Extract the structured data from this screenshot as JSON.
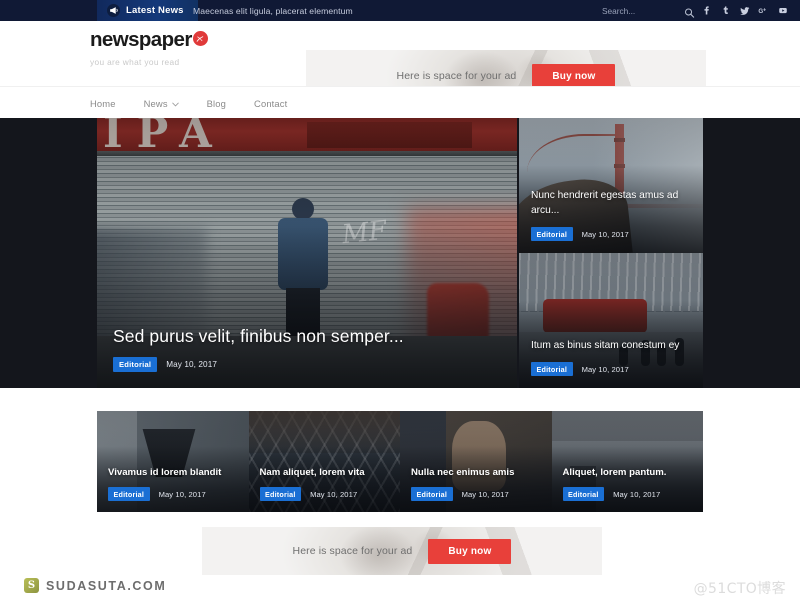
{
  "topbar": {
    "latest_news_label": "Latest News",
    "megaphone_icon": "megaphone-icon",
    "ticker_text": "Maecenas elit ligula, placerat elementum",
    "search_placeholder": "Search...",
    "search_value": "",
    "search_icon": "search-icon",
    "socials": [
      {
        "name": "facebook-icon",
        "label": "f"
      },
      {
        "name": "tumblr-icon",
        "label": "t"
      },
      {
        "name": "twitter-icon",
        "label": "y"
      },
      {
        "name": "google-plus-icon",
        "label": "G+"
      },
      {
        "name": "youtube-icon",
        "label": "yt"
      }
    ],
    "bg_color": "#101935",
    "latest_bg_color": "#123a7a"
  },
  "header": {
    "logo_text": "newspaper",
    "logo_mark": "red-circle-icon",
    "logo_mark_color": "#e03a3a",
    "tagline": "you are what you read"
  },
  "ad_top": {
    "text": "Here is space for your ad",
    "button_label": "Buy now",
    "button_color": "#e8403a"
  },
  "ad_bottom": {
    "text": "Here is space for your ad",
    "button_label": "Buy now",
    "button_color": "#e8403a"
  },
  "nav": {
    "items": [
      {
        "label": "Home",
        "has_dropdown": false
      },
      {
        "label": "News",
        "has_dropdown": true
      },
      {
        "label": "Blog",
        "has_dropdown": false
      },
      {
        "label": "Contact",
        "has_dropdown": false
      }
    ]
  },
  "hero": {
    "main": {
      "title": "Sed purus velit, finibus non semper...",
      "category": "Editorial",
      "date": "May 10, 2017",
      "sign_letters": "IPA"
    },
    "side": [
      {
        "title": "Nunc hendrerit egestas amus ad arcu...",
        "category": "Editorial",
        "date": "May 10, 2017"
      },
      {
        "title": "Itum as binus sitam conestum ey",
        "category": "Editorial",
        "date": "May 10, 2017"
      }
    ]
  },
  "grid": {
    "cards": [
      {
        "title": "Vivamus id lorem blandit",
        "category": "Editorial",
        "date": "May 10, 2017"
      },
      {
        "title": "Nam aliquet, lorem vita",
        "category": "Editorial",
        "date": "May 10, 2017"
      },
      {
        "title": "Nulla nec enimus amis",
        "category": "Editorial",
        "date": "May 10, 2017"
      },
      {
        "title": "Aliquet, lorem pantum.",
        "category": "Editorial",
        "date": "May 10, 2017"
      }
    ]
  },
  "watermarks": {
    "left_text": "SUDASUTA.COM",
    "left_icon": "sudasuta-logo-icon",
    "right_text": "@51CTO博客"
  },
  "colors": {
    "badge_blue": "#1a6fd4",
    "accent_red": "#e8403a",
    "topbar_navy": "#101935"
  }
}
